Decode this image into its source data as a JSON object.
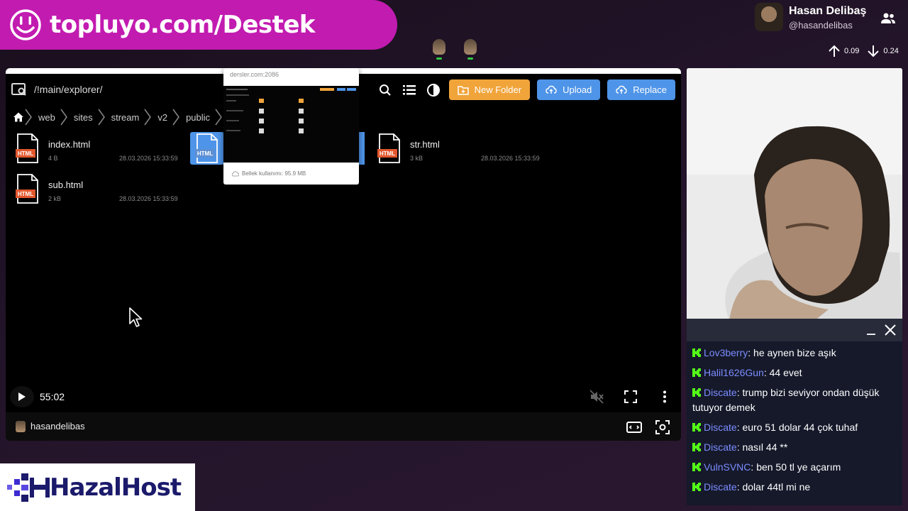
{
  "banner": {
    "text": "topluyo.com/Destek"
  },
  "streamer": {
    "name": "Hasan Delibaş",
    "handle": "@hasandelibas"
  },
  "net_stats": {
    "up": "0.09",
    "down": "0.24"
  },
  "explorer": {
    "path": "/!main/explorer/",
    "buttons": {
      "new_folder": "New Folder",
      "upload": "Upload",
      "replace": "Replace"
    },
    "breadcrumb": [
      "web",
      "sites",
      "stream",
      "v2",
      "public"
    ],
    "files": [
      {
        "name": "index.html",
        "size": "4 B",
        "date": "28.03.2026 15:33:59",
        "type": "HTML"
      },
      {
        "name": "str.html",
        "size": "3 kB",
        "date": "28.03.2026 15:33:59",
        "type": "HTML"
      },
      {
        "name": "sub.html",
        "size": "2 kB",
        "date": "28.03.2026 15:33:59",
        "type": "HTML"
      }
    ],
    "selected_file_type": "HTML",
    "popup": {
      "title": "dersler.com:2086",
      "footer": "Bellek kullanımı: 95.9 MB"
    }
  },
  "player": {
    "time": "55:02",
    "channel": "hasandelibas"
  },
  "chat": {
    "messages": [
      {
        "user": "Lov3berry",
        "text": "he aynen bize aşık"
      },
      {
        "user": "Halil1626Gun",
        "text": "44 evet"
      },
      {
        "user": "Discate",
        "text": "trump bizi seviyor ondan düşük tutuyor demek"
      },
      {
        "user": "Discate",
        "text": "euro 51 dolar 44 çok tuhaf"
      },
      {
        "user": "Discate",
        "text": "nasıl 44 **"
      },
      {
        "user": "VulnSVNC",
        "text": "ben 50 tl ye açarım"
      },
      {
        "user": "Discate",
        "text": "dolar 44tl mi ne"
      }
    ]
  },
  "sponsor": {
    "text": "HazalHost"
  },
  "colors": {
    "banner": "#c21bb0",
    "new_folder": "#f0a43a",
    "upload": "#4e94e8",
    "chat_bg": "#15192a",
    "chat_user": "#7c8cff",
    "badge": "#53fc18",
    "sponsor_text": "#1b1a6b"
  }
}
